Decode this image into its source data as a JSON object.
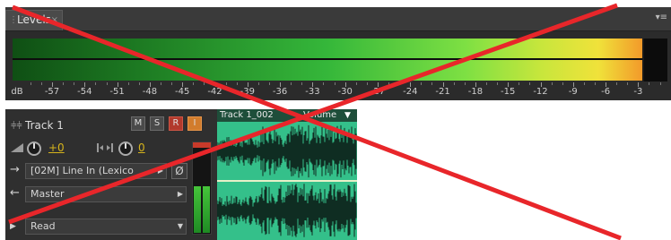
{
  "levels": {
    "tab_label": "Levels",
    "tab_close_glyph": "×",
    "grip_glyph": "⋮⋮",
    "menu_glyph": "▾≡",
    "scale_unit": "dB",
    "scale_labels": [
      "-57",
      "-54",
      "-51",
      "-48",
      "-45",
      "-42",
      "-39",
      "-36",
      "-33",
      "-30",
      "-27",
      "-24",
      "-21",
      "-18",
      "-15",
      "-12",
      "-9",
      "-6",
      "-3"
    ],
    "level_left_fraction": 0.945,
    "level_right_fraction": 0.945
  },
  "track": {
    "grip_glyph": "⫩⫩",
    "name": "Track 1",
    "mute_label": "M",
    "solo_label": "S",
    "record_label": "R",
    "input_monitor_label": "I",
    "volume_value": "+0",
    "pan_value": "0",
    "input_label": "[02M] Line In (Lexico",
    "input_arrow": "→",
    "phase_glyph": "Ø",
    "output_label": "Master",
    "output_arrow": "←",
    "automation_mode": "Read",
    "expand_glyph": "▶",
    "dropdown_caret": "▶",
    "select_caret": "▼"
  },
  "clip": {
    "name": "Track 1_002",
    "envelope_label": "Volume",
    "menu_glyph": "▼"
  },
  "colors": {
    "overlay_cross": "#e8262a",
    "clip_background": "#34c08a",
    "clip_header": "#1e4e3a",
    "value_text": "#d6b41c",
    "record_button": "#b23a2c",
    "input_button": "#d27c2c"
  },
  "icons": {
    "volume": "volume-ramp-icon",
    "pan": "pan-icon",
    "input": "input-arrow-icon",
    "output": "output-arrow-icon",
    "phase": "phase-invert-icon"
  }
}
